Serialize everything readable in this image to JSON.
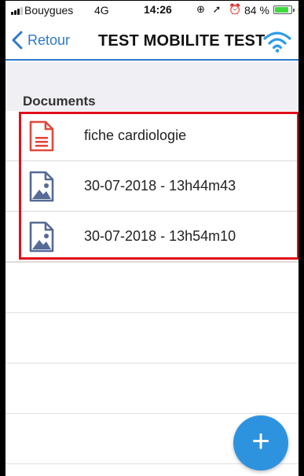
{
  "status_bar": {
    "carrier": "Bouygues",
    "network": "4G",
    "time": "14:26",
    "icons": "⊕ ➚ ⏰",
    "battery": "84 %",
    "charging_glyph": "⚡"
  },
  "nav": {
    "back_label": "Retour",
    "title": "TEST MOBILITE TEST",
    "accent_color": "#2d79c6",
    "right_icon": "wifi-icon"
  },
  "documents": {
    "section_title": "Documents",
    "items": [
      {
        "label": "fiche cardiologie",
        "icon": "pdf-document-icon"
      },
      {
        "label": "30-07-2018 - 13h44m43",
        "icon": "image-document-icon"
      },
      {
        "label": "30-07-2018 - 13h54m10",
        "icon": "image-document-icon"
      }
    ]
  },
  "fab": {
    "symbol": "+",
    "icon": "add-icon",
    "color": "#2e93df"
  },
  "highlight_color": "#e0101a"
}
